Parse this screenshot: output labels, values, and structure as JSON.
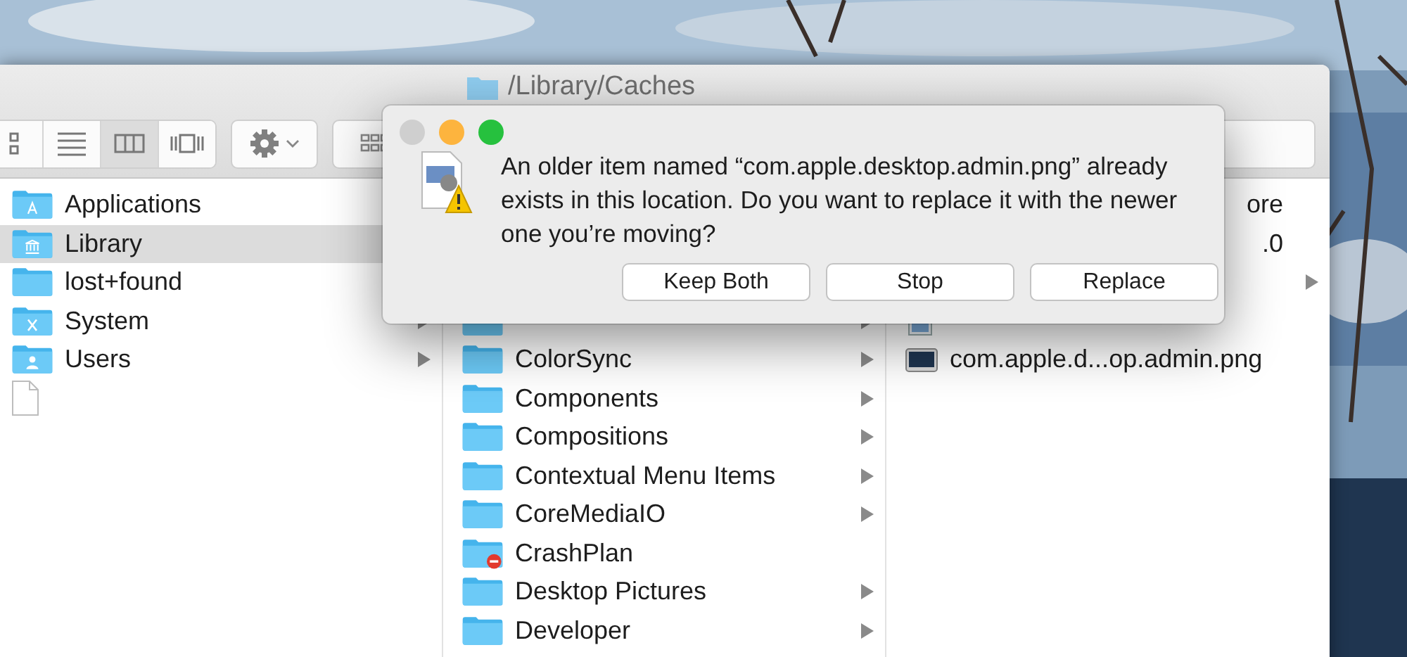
{
  "window": {
    "title": "/Library/Caches"
  },
  "toolbar": {
    "view_modes": [
      {
        "kind": "icon",
        "selected": false
      },
      {
        "kind": "list",
        "selected": false
      },
      {
        "kind": "columns",
        "selected": true
      },
      {
        "kind": "coverflow",
        "selected": false
      }
    ]
  },
  "columns": [
    {
      "items": [
        {
          "name": "Applications",
          "kind": "apps-folder",
          "selected": false
        },
        {
          "name": "Library",
          "kind": "library-folder",
          "selected": true
        },
        {
          "name": "lost+found",
          "kind": "folder",
          "selected": false
        },
        {
          "name": "System",
          "kind": "system-folder",
          "has_children": true,
          "selected": false
        },
        {
          "name": "Users",
          "kind": "users-folder",
          "has_children": true,
          "selected": false
        },
        {
          "kind": "file",
          "has_children": false,
          "selected": false
        }
      ]
    },
    {
      "items": [
        {
          "kind": "folder",
          "has_children": true,
          "selected": false
        },
        {
          "name": "ColorSync",
          "kind": "folder",
          "has_children": true,
          "selected": false
        },
        {
          "name": "Components",
          "kind": "folder",
          "has_children": true,
          "selected": false
        },
        {
          "name": "Compositions",
          "kind": "folder",
          "has_children": true,
          "selected": false
        },
        {
          "name": "Contextual Menu Items",
          "kind": "folder",
          "has_children": true,
          "selected": false
        },
        {
          "name": "CoreMediaIO",
          "kind": "folder",
          "has_children": true,
          "selected": false
        },
        {
          "name": "CrashPlan",
          "kind": "blocked-folder",
          "has_children": false,
          "selected": false
        },
        {
          "name": "Desktop Pictures",
          "kind": "folder",
          "has_children": true,
          "selected": false
        },
        {
          "name": "Developer",
          "kind": "folder",
          "has_children": true,
          "selected": false
        }
      ]
    },
    {
      "items": [
        {
          "name": "ore",
          "kind": "covered",
          "has_children": false,
          "selected": false
        },
        {
          "name": ".0",
          "kind": "covered",
          "has_children": false,
          "selected": false
        },
        {
          "kind": "covered",
          "has_children": true,
          "selected": false
        },
        {
          "kind": "plist-file",
          "has_children": false,
          "selected": false
        },
        {
          "name": "com.apple.d...op.admin.png",
          "kind": "image-file",
          "has_children": false,
          "selected": false
        }
      ]
    }
  ],
  "dialog": {
    "message": "An older item named “com.apple.desktop.admin.png” already exists in this location. Do you want to replace it with the newer one you’re moving?",
    "buttons": [
      "Keep Both",
      "Stop",
      "Replace"
    ]
  }
}
